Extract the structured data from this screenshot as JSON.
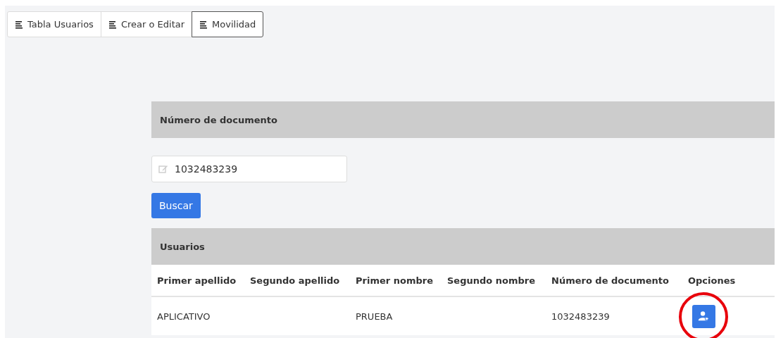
{
  "tabs": [
    {
      "label": "Tabla Usuarios",
      "selected": false
    },
    {
      "label": "Crear o Editar",
      "selected": false
    },
    {
      "label": "Movilidad",
      "selected": true
    }
  ],
  "search_panel": {
    "title": "Número de documento",
    "field": {
      "value": "1032483239"
    },
    "button": "Buscar"
  },
  "users_panel": {
    "title": "Usuarios",
    "columns": [
      "Primer apellido",
      "Segundo apellido",
      "Primer nombre",
      "Segundo nombre",
      "Número de documento",
      "Opciones"
    ],
    "rows": [
      {
        "cells": [
          "APLICATIVO",
          "",
          "PRUEBA",
          "",
          "1032483239"
        ],
        "option_highlighted": true
      }
    ]
  }
}
